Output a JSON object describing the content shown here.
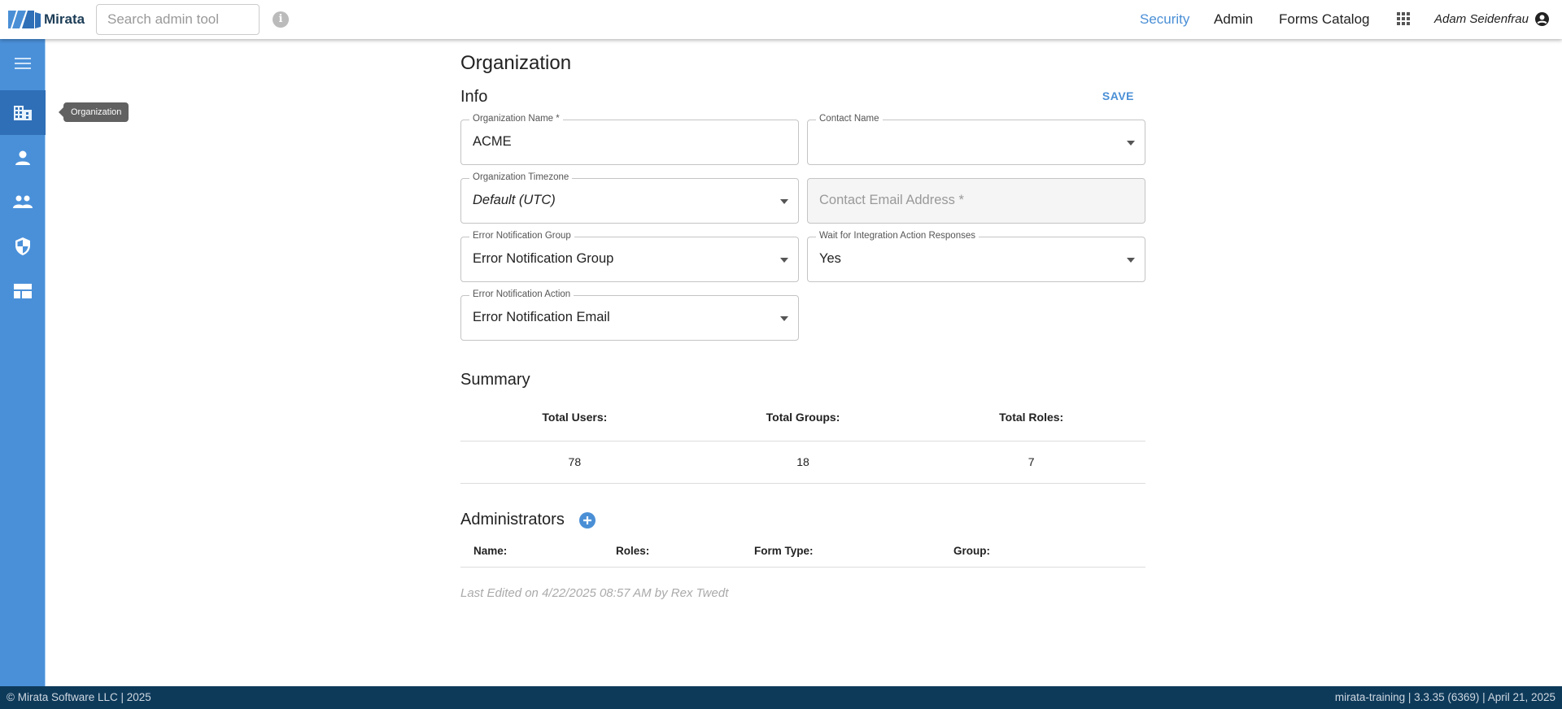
{
  "header": {
    "logo": "Mirata",
    "search_placeholder": "Search admin tool",
    "nav": [
      "Security",
      "Admin",
      "Forms Catalog"
    ],
    "active_nav": "Security",
    "user": "Adam Seidenfrau"
  },
  "sidebar": {
    "items": [
      "menu",
      "organization",
      "users",
      "groups",
      "security",
      "layouts"
    ],
    "active": "organization",
    "tooltip": "Organization"
  },
  "page": {
    "title": "Organization",
    "info_heading": "Info",
    "save_label": "SAVE",
    "fields": [
      {
        "label": "Organization Name *",
        "value": "ACME"
      },
      {
        "label": "Contact Name",
        "value": ""
      },
      {
        "label": "Organization Timezone",
        "value": "Default (UTC)"
      },
      {
        "placeholder": "Contact Email Address *"
      },
      {
        "label": "Error Notification Group",
        "value": "Error Notification Group"
      },
      {
        "label": "Wait for Integration Action Responses",
        "value": "Yes"
      },
      {
        "label": "Error Notification Action",
        "value": "Error Notification Email"
      }
    ],
    "summary": {
      "heading": "Summary",
      "headers": [
        "Total Users:",
        "Total Groups:",
        "Total Roles:"
      ],
      "values": [
        "78",
        "18",
        "7"
      ]
    },
    "administrators": {
      "heading": "Administrators",
      "columns": [
        "Name:",
        "Roles:",
        "Form Type:",
        "Group:"
      ]
    },
    "last_edited": "Last Edited on 4/22/2025 08:57 AM by Rex Twedt"
  },
  "footer": {
    "left": "© Mirata Software LLC | 2025",
    "right": "mirata-training | 3.3.35 (6369) | April 21, 2025"
  },
  "colors": {
    "accent": "#4a8fd6",
    "sidebar": "#4a90d9",
    "footer": "#0e3a5a"
  }
}
